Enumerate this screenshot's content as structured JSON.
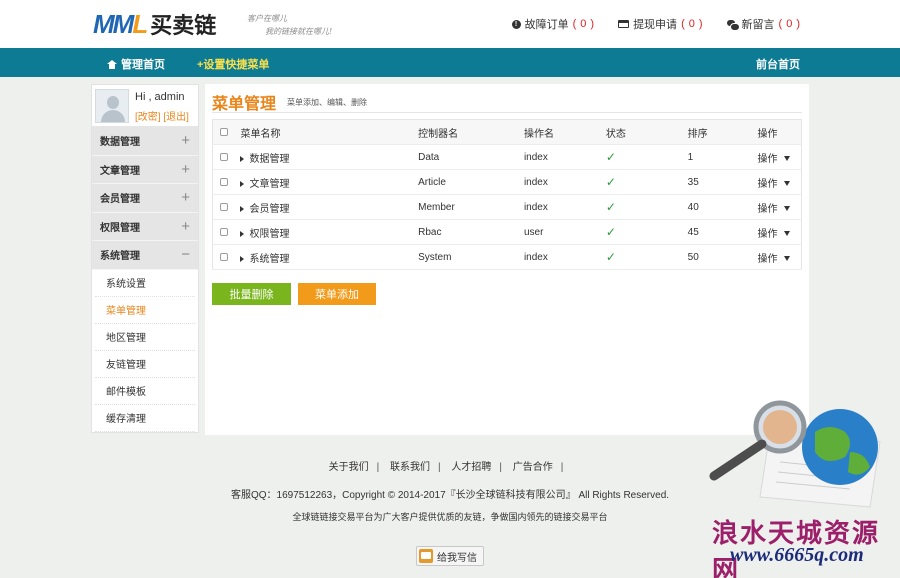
{
  "header": {
    "logo_mark_a": "MM",
    "logo_mark_b": "L",
    "logo_cn": "买卖链",
    "slogan_l1": "客户在哪儿",
    "slogan_l2": "我的链接就在哪儿!",
    "links": [
      {
        "label": "故障订单",
        "count": "0",
        "icon": "info-icon"
      },
      {
        "label": "提现申请",
        "count": "0",
        "icon": "card-icon"
      },
      {
        "label": "新留言",
        "count": "0",
        "icon": "chat-icon"
      }
    ]
  },
  "nav": {
    "home": "管理首页",
    "quick": "+设置快捷菜单",
    "front": "前台首页"
  },
  "sidebar": {
    "greeting": "Hi , admin",
    "edit": "[改密]",
    "logout": "[退出]",
    "groups": [
      {
        "label": "数据管理",
        "sign": "+"
      },
      {
        "label": "文章管理",
        "sign": "+"
      },
      {
        "label": "会员管理",
        "sign": "+"
      },
      {
        "label": "权限管理",
        "sign": "+"
      },
      {
        "label": "系统管理",
        "sign": "−"
      }
    ],
    "subitems": [
      "系统设置",
      "菜单管理",
      "地区管理",
      "友链管理",
      "邮件模板",
      "缓存清理"
    ],
    "active_subitem": "菜单管理"
  },
  "main": {
    "title": "菜单管理",
    "subtitle": "菜单添加、编辑、删除",
    "columns": [
      "菜单名称",
      "控制器名",
      "操作名",
      "状态",
      "排序",
      "操作"
    ],
    "rows": [
      {
        "name": "数据管理",
        "controller": "Data",
        "action": "index",
        "status": "✓",
        "sort": "1",
        "op": "操作"
      },
      {
        "name": "文章管理",
        "controller": "Article",
        "action": "index",
        "status": "✓",
        "sort": "35",
        "op": "操作"
      },
      {
        "name": "会员管理",
        "controller": "Member",
        "action": "index",
        "status": "✓",
        "sort": "40",
        "op": "操作"
      },
      {
        "name": "权限管理",
        "controller": "Rbac",
        "action": "user",
        "status": "✓",
        "sort": "45",
        "op": "操作"
      },
      {
        "name": "系统管理",
        "controller": "System",
        "action": "index",
        "status": "✓",
        "sort": "50",
        "op": "操作"
      }
    ],
    "btn_delete": "批量删除",
    "btn_add": "菜单添加"
  },
  "footer": {
    "links": [
      "关于我们",
      "联系我们",
      "人才招聘",
      "广告合作"
    ],
    "sep": "|",
    "copyright": "客服QQ：1697512263，Copyright © 2014-2017『长沙全球链科技有限公司』 All Rights Reserved.",
    "desc": "全球链链接交易平台为广大客户提供优质的友链，争做国内领先的链接交易平台",
    "write": "给我写信"
  },
  "watermark": {
    "text": "浪水天城资源网",
    "url": "www.6665q.com"
  },
  "colors": {
    "nav_bg": "#0e7b95",
    "accent": "#e8861b",
    "green_button": "#7ab51d",
    "orange_button": "#f29a19",
    "quick_menu": "#f9e04b",
    "check": "#2b9b3a"
  }
}
